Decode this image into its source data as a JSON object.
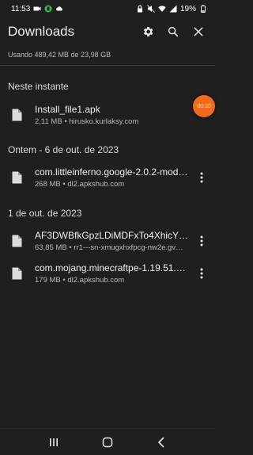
{
  "status_bar": {
    "time": "11:53",
    "battery": "19%",
    "icons_left": [
      "camera-icon",
      "notification-badge-icon",
      "cloud-icon"
    ],
    "icons_right": [
      "lock-icon",
      "mute-icon",
      "wifi-icon",
      "signal-icon",
      "battery-icon"
    ]
  },
  "app_bar": {
    "title": "Downloads",
    "actions": [
      "settings-icon",
      "search-icon",
      "close-icon"
    ]
  },
  "storage_text": "Usando 489,42 MB de 23,98 GB",
  "sections": [
    {
      "header": "Neste instante",
      "items": [
        {
          "name": "Install_file1.apk",
          "meta": "2,11 MB • hirusko.kurlaksy.com",
          "has_more": false
        }
      ]
    },
    {
      "header": "Ontem - 6 de out. de 2023",
      "items": [
        {
          "name": "com.littleinferno.google-2.0.2-mod-…",
          "meta": "268 MB • dl2.apkshub.com",
          "has_more": true
        }
      ]
    },
    {
      "header": "1 de out. de 2023",
      "items": [
        {
          "name": "AF3DWBfkGpzLDiMDFxTo4XhicYUC…",
          "meta": "63,85 MB • rr1---sn-xmugxhxfpcg-nw2e.gv…",
          "has_more": true
        },
        {
          "name": "com.mojang.minecraftpe-1.19.51.0…",
          "meta": "179 MB • dl2.apkshub.com",
          "has_more": true
        }
      ]
    }
  ],
  "floating_bubble": {
    "label": "00:10",
    "color": "#f26b1d"
  },
  "nav_bar": [
    "recents-icon",
    "home-icon",
    "back-icon"
  ],
  "colors": {
    "background": "#1f1f1f",
    "text": "#f0f0f0",
    "secondary_text": "#b8b8b8"
  }
}
